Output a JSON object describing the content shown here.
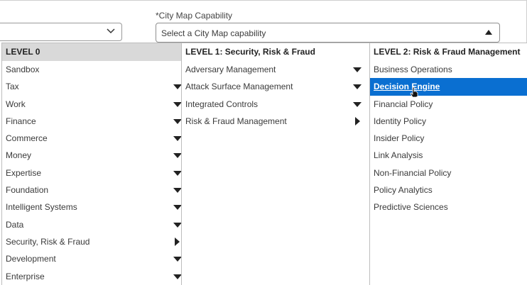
{
  "field": {
    "label": "*City Map Capability",
    "placeholder": "Select a City Map capability"
  },
  "columns": [
    {
      "header": "LEVEL 0",
      "items": [
        {
          "label": "Sandbox",
          "arrow": "none"
        },
        {
          "label": "Tax",
          "arrow": "down"
        },
        {
          "label": "Work",
          "arrow": "down"
        },
        {
          "label": "Finance",
          "arrow": "down"
        },
        {
          "label": "Commerce",
          "arrow": "down"
        },
        {
          "label": "Money",
          "arrow": "down"
        },
        {
          "label": "Expertise",
          "arrow": "down"
        },
        {
          "label": "Foundation",
          "arrow": "down"
        },
        {
          "label": "Intelligent Systems",
          "arrow": "down"
        },
        {
          "label": "Data",
          "arrow": "down"
        },
        {
          "label": "Security, Risk & Fraud",
          "arrow": "right"
        },
        {
          "label": "Development",
          "arrow": "down"
        },
        {
          "label": "Enterprise",
          "arrow": "down"
        }
      ]
    },
    {
      "header": "LEVEL 1: Security, Risk & Fraud",
      "items": [
        {
          "label": "Adversary Management",
          "arrow": "down"
        },
        {
          "label": "Attack Surface Management",
          "arrow": "down"
        },
        {
          "label": "Integrated Controls",
          "arrow": "down"
        },
        {
          "label": "Risk & Fraud Management",
          "arrow": "right"
        }
      ]
    },
    {
      "header": "LEVEL 2: Risk & Fraud Management",
      "items": [
        {
          "label": "Business Operations",
          "arrow": "none"
        },
        {
          "label": "Decision Engine",
          "arrow": "none",
          "selected": true
        },
        {
          "label": "Financial Policy",
          "arrow": "none"
        },
        {
          "label": "Identity Policy",
          "arrow": "none"
        },
        {
          "label": "Insider Policy",
          "arrow": "none"
        },
        {
          "label": "Link Analysis",
          "arrow": "none"
        },
        {
          "label": "Non-Financial Policy",
          "arrow": "none"
        },
        {
          "label": "Policy Analytics",
          "arrow": "none"
        },
        {
          "label": "Predictive Sciences",
          "arrow": "none"
        }
      ]
    }
  ],
  "colors": {
    "selected_bg": "#0a6fd1",
    "level0_header_bg": "#d9d9d9"
  },
  "icons": {
    "left_select": "chevron-down-icon",
    "city_select": "caret-up-icon",
    "cursor": "hand-pointer-icon"
  }
}
